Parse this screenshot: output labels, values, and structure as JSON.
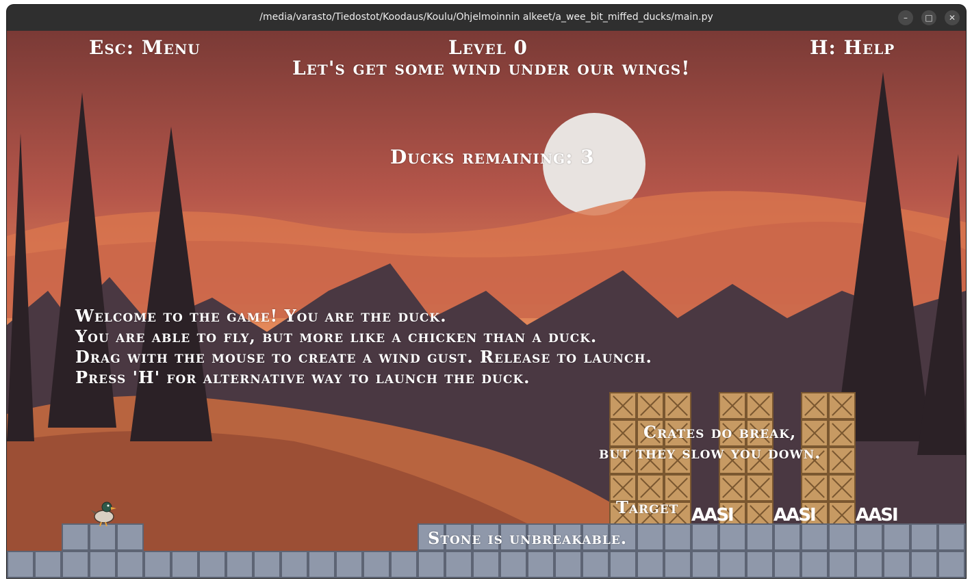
{
  "window": {
    "title": "/media/varasto/Tiedostot/Koodaus/Koulu/Ohjelmoinnin alkeet/a_wee_bit_miffed_ducks/main.py",
    "minimize_icon": "minimize-icon",
    "maximize_icon": "maximize-icon",
    "close_icon": "close-icon"
  },
  "hud": {
    "menu_hint": "Esc: Menu",
    "level": "Level 0",
    "help_hint": "H: Help",
    "subtitle": "Let's get some wind under our wings!",
    "ducks_remaining": "Ducks remaining: 3"
  },
  "tutorial": {
    "lines": [
      "Welcome to the game! You are the duck.",
      "You are able to fly, but more like a chicken than a duck.",
      "Drag with the mouse to create a wind gust. Release to launch.",
      "Press 'H' for alternative way to launch the duck."
    ]
  },
  "hints": {
    "crates_line1": "Crates do break,",
    "crates_line2": "but they slow you down.",
    "stone": "Stone is unbreakable.",
    "target": "Target"
  },
  "targets": [
    "AASI",
    "AASI",
    "AASI"
  ],
  "colors": {
    "sky_top": "#8a4a3c",
    "sky_mid": "#e0744a",
    "hill": "#b8643f",
    "forest": "#3a2f3a",
    "crate": "#c79a63",
    "stone": "#8f98aa"
  }
}
